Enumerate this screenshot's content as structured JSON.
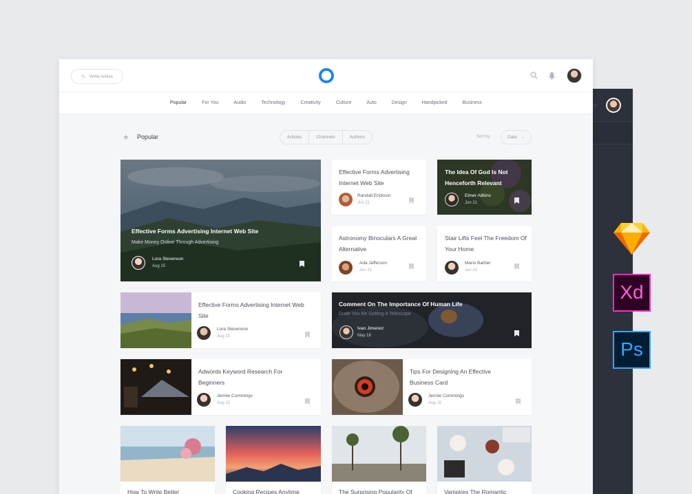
{
  "app": {
    "write_label": "Write Article"
  },
  "categories": [
    "Popular",
    "For You",
    "Audio",
    "Technology",
    "Creativity",
    "Culture",
    "Auto",
    "Design",
    "Handpicked",
    "Business"
  ],
  "section": {
    "title": "Popular",
    "tabs": [
      "Articles",
      "Channels",
      "Authors"
    ],
    "sort_label": "Sort by:",
    "sort_value": "Date"
  },
  "cards": {
    "hero": {
      "title": "Effective Forms Advertising Internet Web Site",
      "subtitle": "Make Money Online Through Advertising",
      "author": "Lora Stevenson",
      "date": "Aug 15"
    },
    "c1": {
      "title": "Effective Forms Advertising Internet Web Site",
      "author": "Randall Erickson",
      "date": "Jun 21"
    },
    "c2": {
      "title": "The Idea Of God Is Not Henceforth Relevant",
      "author": "Elmer Adkins",
      "date": "Jun 21"
    },
    "c3": {
      "title": "Astronomy Binoculars A Great Alternative",
      "author": "Ada Jefferson",
      "date": "Jun 21"
    },
    "c4": {
      "title": "Stair Lifts Feel The Freedom Of Your Home",
      "author": "Mario Barber",
      "date": "Jun 21"
    },
    "c5": {
      "title": "Effective Forms Advertising Internet Web Site",
      "author": "Lora Stevenson",
      "date": "Aug 15"
    },
    "c6": {
      "title": "Comment On The Importance Of Human Life",
      "subtitle": "Dude You Re Getting A Telescope",
      "author": "Ivan Jimenez",
      "date": "May 18"
    },
    "c7": {
      "title": "Adwords Keyword Research For Beginners",
      "author": "Jennie Cummings",
      "date": "Aug 15"
    },
    "c8": {
      "title": "Tips For Designing An Effective Business Card",
      "author": "Jennie Cummings",
      "date": "Aug 15"
    },
    "b1": {
      "title": "How To Write Better"
    },
    "b2": {
      "title": "Cooking Recipes Anytime"
    },
    "b3": {
      "title": "The Surprising Popularity Of"
    },
    "b4": {
      "title": "Vampires The Romantic"
    }
  },
  "colors": {
    "accent": "#1e86e8",
    "dark_panel": "#2d313c"
  }
}
